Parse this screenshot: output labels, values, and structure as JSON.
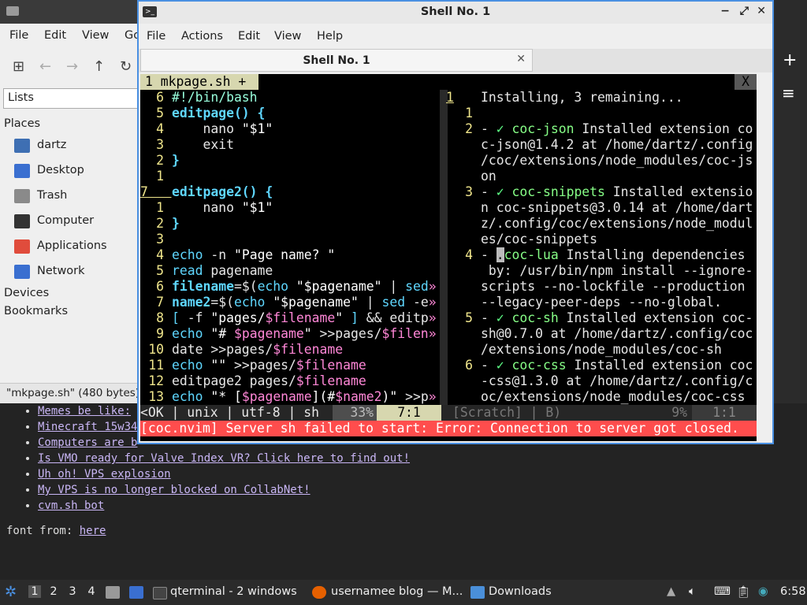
{
  "file_manager": {
    "menu": [
      "File",
      "Edit",
      "View",
      "Go"
    ],
    "toolbar_icons": [
      "new-tab-icon",
      "back-arrow-icon",
      "forward-arrow-icon",
      "up-arrow-icon",
      "reload-icon"
    ],
    "view_mode": "Lists",
    "places_heading": "Places",
    "places": [
      {
        "label": "dartz",
        "icon": "home-folder-icon",
        "color": "#3e6fb3"
      },
      {
        "label": "Desktop",
        "icon": "desktop-icon",
        "color": "#3a6fd0"
      },
      {
        "label": "Trash",
        "icon": "trash-icon",
        "color": "#8a8a8a"
      },
      {
        "label": "Computer",
        "icon": "computer-icon",
        "color": "#333333"
      },
      {
        "label": "Applications",
        "icon": "applications-icon",
        "color": "#e04c3c"
      },
      {
        "label": "Network",
        "icon": "network-icon",
        "color": "#3a6fd0"
      }
    ],
    "devices_heading": "Devices",
    "bookmarks_heading": "Bookmarks",
    "status": "\"mkpage.sh\" (480 bytes)"
  },
  "blog": {
    "links": [
      "Memes be like:",
      "Minecraft 15w34a",
      "Computers are b",
      "Is VMO ready for Valve Index VR? Click here to find out!",
      "Uh oh! VPS explosion",
      "My VPS is no longer blocked on CollabNet!",
      "cvm.sh bot"
    ],
    "font_label": "font from: ",
    "font_link": "here"
  },
  "terminal": {
    "title": "Shell No. 1",
    "window_buttons": [
      "−",
      "⤢",
      "✕"
    ],
    "menu": [
      "File",
      "Actions",
      "Edit",
      "View",
      "Help"
    ],
    "tab_label": "Shell No. 1",
    "tab_close": "✕",
    "vim": {
      "tab_label": "1  mkpage.sh  +",
      "tab_close": "X",
      "left_lines": [
        {
          "n": "6",
          "html": "<span class='cmt'>#!/bin/bash</span>"
        },
        {
          "n": "5",
          "html": "<span class='kw'>editpage() {</span>"
        },
        {
          "n": "4",
          "html": "    nano <span class='str'>\"$1\"</span>"
        },
        {
          "n": "3",
          "html": "    exit"
        },
        {
          "n": "2",
          "html": "<span class='kw'>}</span>"
        },
        {
          "n": "1",
          "html": ""
        },
        {
          "n": "7",
          "cur": true,
          "html": "<span class='kw'>editpage2() {</span>"
        },
        {
          "n": "1",
          "html": "    nano <span class='str'>\"$1\"</span>"
        },
        {
          "n": "2",
          "html": "<span class='kw'>}</span>"
        },
        {
          "n": "3",
          "html": ""
        },
        {
          "n": "4",
          "html": "<span class='cmd'>echo</span> -n <span class='str'>\"Page name? \"</span>"
        },
        {
          "n": "5",
          "html": "<span class='cmd'>read</span> pagename"
        },
        {
          "n": "6",
          "html": "<span class='kw'>filename</span>=$(<span class='cmd'>echo</span> <span class='str'>\"$pagename\"</span> | <span class='cmd'>sed</span><span class='var'>»</span>"
        },
        {
          "n": "7",
          "html": "<span class='kw'>name2</span>=$(<span class='cmd'>echo</span> <span class='str'>\"$pagename\"</span> | <span class='cmd'>sed</span> -e<span class='var'>»</span>"
        },
        {
          "n": "8",
          "html": "<span class='cmd'>[</span> -f <span class='str'>\"pages/<span class='var'>$filename</span>\"</span> <span class='cmd'>]</span> && editp<span class='var'>»</span>"
        },
        {
          "n": "9",
          "html": "<span class='cmd'>echo</span> <span class='str'>\"# <span class='var'>$pagename</span>\"</span> >>pages/<span class='var'>$filen</span><span class='var'>»</span>"
        },
        {
          "n": "10",
          "html": "date >>pages/<span class='var'>$filename</span>"
        },
        {
          "n": "11",
          "html": "<span class='cmd'>echo</span> <span class='str'>\"\"</span> >>pages/<span class='var'>$filename</span>"
        },
        {
          "n": "12",
          "html": "editpage2 pages/<span class='var'>$filename</span>"
        },
        {
          "n": "13",
          "html": "<span class='cmd'>echo</span> <span class='str'>\"* [<span class='var'>$pagename</span>](#<span class='var'>$name2</span>)\"</span> >>p<span class='var'>»</span>"
        }
      ],
      "right_lines": [
        {
          "n": "1",
          "first": true,
          "text": "Installing, 3 remaining..."
        },
        {
          "n": "1",
          "text": ""
        },
        {
          "n": "2",
          "html": "- <span style='color:#5fff87'>✓</span> <span style='color:#87ff87'>coc-json</span> Installed extension co"
        },
        {
          "n": "",
          "text": "c-json@1.4.2 at /home/dartz/.config"
        },
        {
          "n": "",
          "text": "/coc/extensions/node_modules/coc-js"
        },
        {
          "n": "",
          "text": "on"
        },
        {
          "n": "3",
          "html": "- <span style='color:#5fff87'>✓</span> <span style='color:#87ff87'>coc-snippets</span> Installed extensio"
        },
        {
          "n": "",
          "text": "n coc-snippets@3.0.14 at /home/dart"
        },
        {
          "n": "",
          "text": "z/.config/coc/extensions/node_modul"
        },
        {
          "n": "",
          "text": "es/coc-snippets"
        },
        {
          "n": "4",
          "html": "- <span style='background:#bbb;color:#000'>.</span><span style='color:#87ff87'>coc-lua</span> Installing dependencies"
        },
        {
          "n": "",
          "text": " by: /usr/bin/npm install --ignore-"
        },
        {
          "n": "",
          "text": "scripts --no-lockfile --production"
        },
        {
          "n": "",
          "text": "--legacy-peer-deps --no-global."
        },
        {
          "n": "5",
          "html": "- <span style='color:#5fff87'>✓</span> <span style='color:#87ff87'>coc-sh</span> Installed extension coc-"
        },
        {
          "n": "",
          "text": "sh@0.7.0 at /home/dartz/.config/coc"
        },
        {
          "n": "",
          "text": "/extensions/node_modules/coc-sh"
        },
        {
          "n": "6",
          "html": "- <span style='color:#5fff87'>✓</span> <span style='color:#87ff87'>coc-css</span> Installed extension coc"
        },
        {
          "n": "",
          "text": "-css@1.3.0 at /home/dartz/.config/c"
        },
        {
          "n": "",
          "text": "oc/extensions/node_modules/coc-css"
        }
      ],
      "status_left": "<OK | unix | utf-8 | sh",
      "status_left_pct": "33%",
      "status_left_pos": "7:1",
      "status_right": "[Scratch] | B)",
      "status_right_pct": "9%",
      "status_right_pos": "1:1",
      "error": "[coc.nvim] Server sh failed to start: Error: Connection to server got closed."
    }
  },
  "taskbar": {
    "desktops": [
      "1",
      "2",
      "3",
      "4"
    ],
    "active_desktop": "1",
    "tasks": [
      {
        "label": "qterminal - 2 windows",
        "icon": "terminal-icon"
      },
      {
        "label": "usernamee blog — M...",
        "icon": "firefox-icon"
      },
      {
        "label": "Downloads",
        "icon": "folder-icon"
      }
    ],
    "clock": "6:58"
  },
  "colors": {
    "accent": "#4a90e2",
    "error_bg": "#ff4d4d",
    "link": "#c9b6f5"
  }
}
